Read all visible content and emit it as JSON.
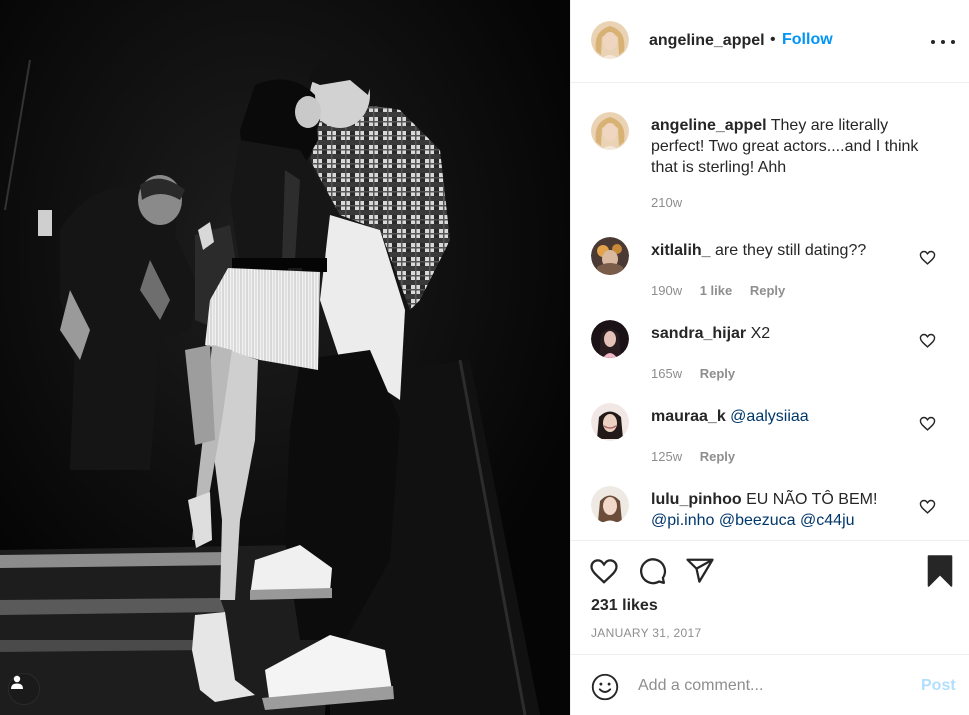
{
  "photo": {
    "alt_icon": "user-tag-icon"
  },
  "header": {
    "username": "angeline_appel",
    "dot": "•",
    "follow_label": "Follow",
    "more_icon": "more-horizontal-icon"
  },
  "comments": [
    {
      "username": "angeline_appel",
      "text": "They are literally perfect! Two great actors....and I think that is sterling! Ahh",
      "time": "210w",
      "likes": "",
      "reply": ""
    },
    {
      "username": "xitlalih_",
      "text": "are they still dating??",
      "time": "190w",
      "likes": "1 like",
      "reply": "Reply"
    },
    {
      "username": "sandra_hijar",
      "text": "X2",
      "time": "165w",
      "likes": "",
      "reply": "Reply"
    },
    {
      "username": "mauraa_k",
      "text": "",
      "mention": "@aalysiiaa",
      "time": "125w",
      "likes": "",
      "reply": "Reply"
    },
    {
      "username": "lulu_pinhoo",
      "text": "EU NÃO TÔ BEM!",
      "mentions": [
        "@pi.inho",
        "@beezuca",
        "@c44ju"
      ]
    }
  ],
  "actions": {
    "like_icon": "heart-icon",
    "comment_icon": "comment-bubble-icon",
    "share_icon": "paper-plane-icon",
    "save_icon": "bookmark-icon",
    "likes_count": "231 likes",
    "date": "JANUARY 31, 2017"
  },
  "add_comment": {
    "emoji_icon": "smiley-icon",
    "placeholder": "Add a comment...",
    "post_label": "Post"
  },
  "colors": {
    "accent": "#0095f6",
    "post_disabled": "#b2dffc",
    "secondary_text": "#8e8e8e",
    "mention": "#00376b"
  }
}
